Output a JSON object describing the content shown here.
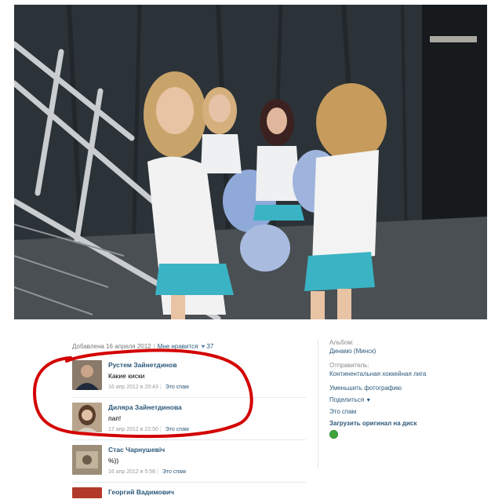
{
  "photo": {
    "alt": ""
  },
  "meta": {
    "added": "Добавлена 16 апреля 2012",
    "likes_label": "Мне нравится",
    "likes_count": "37"
  },
  "comments": [
    {
      "name": "Рустем Зайнетдинов",
      "text": "Какие киски",
      "date": "16 апр 2012 в 20:43",
      "spam": "Это спам"
    },
    {
      "name": "Диляра Зайнетдинова",
      "text": "пап!",
      "date": "17 апр 2012 в 22:50",
      "spam": "Это спам"
    },
    {
      "name": "Стас Чарнушевіч",
      "text": "%))",
      "date": "16 апр 2012 в 5:58",
      "spam": "Это спам"
    },
    {
      "name": "Георгий Вадимович",
      "text": "",
      "date": "",
      "spam": ""
    }
  ],
  "side": {
    "album_label": "Альбом:",
    "album_value": "Динамо (Минск)",
    "sender_label": "Отправитель:",
    "sender_value": "Континентальная хоккейная лига",
    "actions": {
      "reduce": "Уменьшить фотографию",
      "share": "Поделиться",
      "spam": "Это спам",
      "download": "Загрузить оригинал на диск"
    }
  },
  "colors": {
    "link": "#2b587a",
    "marker": "#d40000",
    "uniform_accent": "#3ab3c4"
  },
  "icons": {
    "heart": "heart-icon",
    "caret": "chevron-down-icon",
    "download_status": "green-circle-icon"
  }
}
